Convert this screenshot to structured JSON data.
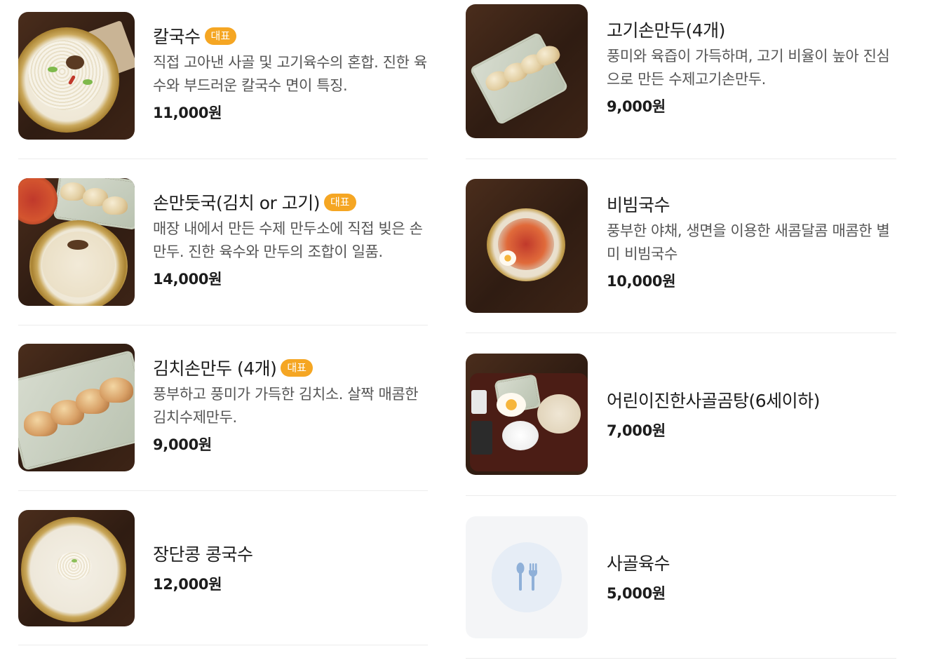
{
  "menu_left": [
    {
      "name": "칼국수",
      "badge": "대표",
      "description": "직접 고아낸 사골 및 고기육수의 혼합. 진한 육수와 부드러운 칼국수 면이 특징.",
      "price": "11,000원"
    },
    {
      "name": "손만둣국(김치 or 고기)",
      "badge": "대표",
      "description": "매장 내에서 만든 수제 만두소에 직접 빚은 손만두. 진한 육수와 만두의 조합이 일품.",
      "price": "14,000원"
    },
    {
      "name": "김치손만두 (4개)",
      "badge": "대표",
      "description": "풍부하고 풍미가 가득한 김치소. 살짝 매콤한 김치수제만두.",
      "price": "9,000원"
    },
    {
      "name": "장단콩 콩국수",
      "badge": "",
      "description": "",
      "price": "12,000원"
    }
  ],
  "menu_right": [
    {
      "name": "고기손만두(4개)",
      "description": "풍미와 육즙이 가득하며, 고기 비율이 높아 진심으로 만든 수제고기손만두.",
      "price": "9,000원"
    },
    {
      "name": "비빔국수",
      "description": "풍부한 야채, 생면을 이용한 새콤달콤 매콤한 별미 비빔국수",
      "price": "10,000원"
    },
    {
      "name": "어린이진한사골곰탕(6세이하)",
      "description": "",
      "price": "7,000원"
    },
    {
      "name": "사골육수",
      "description": "",
      "price": "5,000원",
      "image_icon": "utensils-icon"
    }
  ],
  "colors": {
    "badge": "#f5a623",
    "divider": "#ececec",
    "placeholder_bg": "#f4f5f7",
    "placeholder_circle": "#e6edf6",
    "icon": "#8fb0d8"
  }
}
